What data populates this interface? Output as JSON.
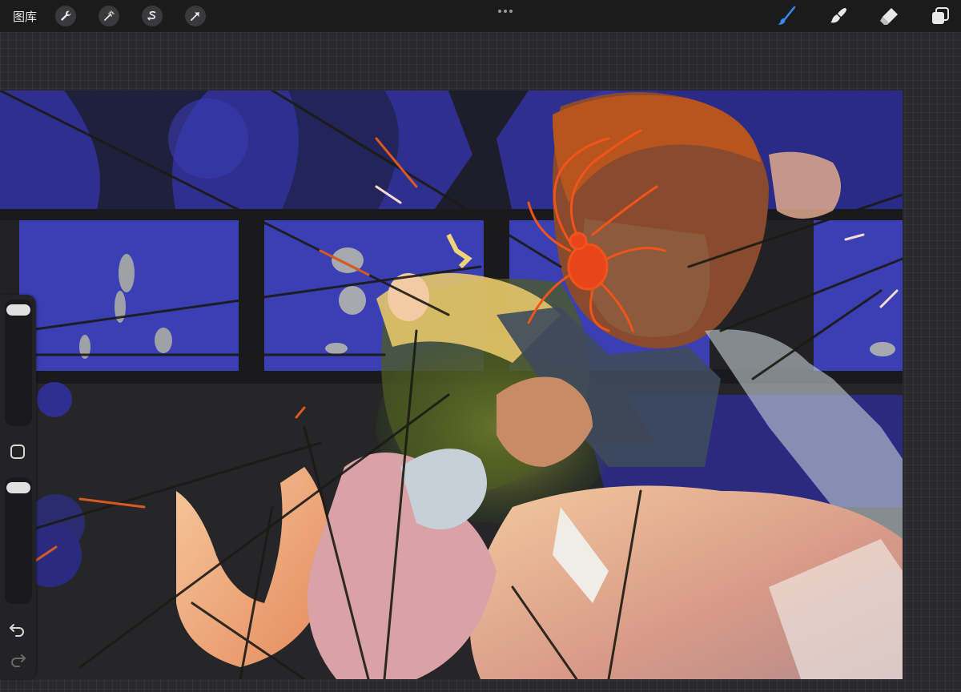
{
  "topbar": {
    "gallery_label": "图库",
    "tools_left": [
      "wrench-icon",
      "magic-wand-icon",
      "selection-s-icon",
      "transform-arrow-icon"
    ],
    "more_icon": "ellipsis-icon",
    "tools_right": [
      "brush-icon",
      "smudge-icon",
      "eraser-icon",
      "layers-icon"
    ],
    "active_tool": "brush",
    "accent_color": "#2f8bf0"
  },
  "sidebar": {
    "brush_size_level": 0.97,
    "opacity_level": 0.97,
    "modify_icon": "square-modify-icon",
    "undo_icon": "undo-icon",
    "redo_icon": "redo-icon"
  },
  "canvas": {
    "artwork": "illustration",
    "palette": [
      "#2b2ea6",
      "#3a3fb0",
      "#1f1f22",
      "#f08a4b",
      "#e84a1e",
      "#f4b38a",
      "#5a6a2a"
    ]
  }
}
